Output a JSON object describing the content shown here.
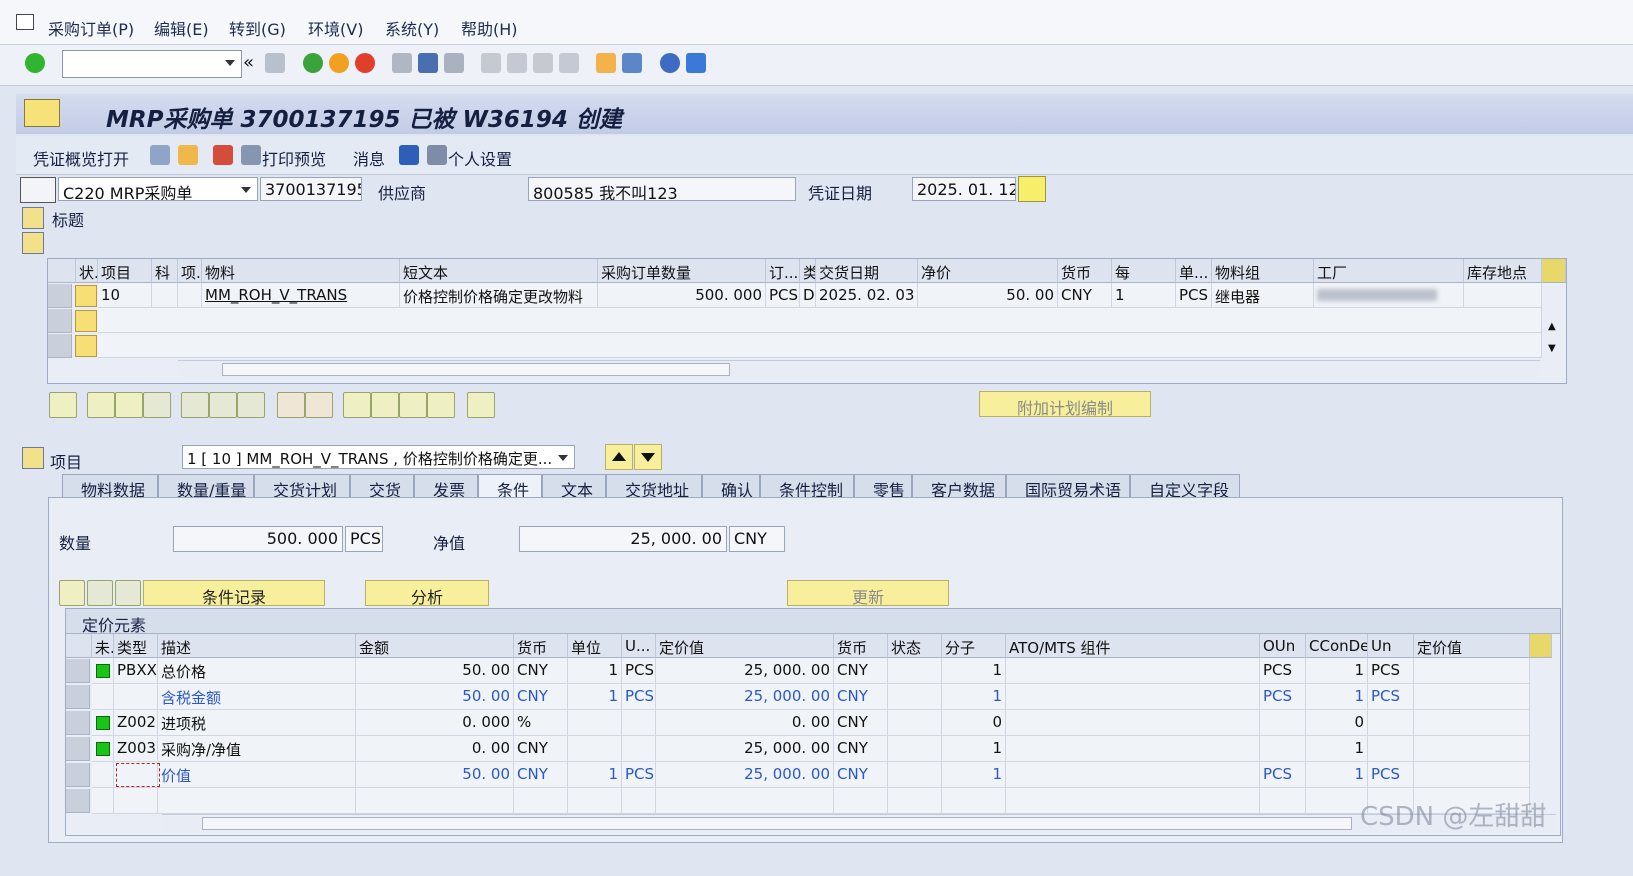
{
  "menu": [
    "采购订单(P)",
    "编辑(E)",
    "转到(G)",
    "环境(V)",
    "系统(Y)",
    "帮助(H)"
  ],
  "title": "MRP采购单 3700137195 已被 W36194 创建",
  "app_toolbar": {
    "overview": "凭证概览打开",
    "print_preview": "打印预览",
    "messages": "消息",
    "personal": "个人设置"
  },
  "header": {
    "doc_type": "C220 MRP采购单",
    "po_number": "3700137195",
    "vendor_label": "供应商",
    "vendor": "800585 我不叫123",
    "date_label": "凭证日期",
    "date": "2025. 01. 12",
    "header_label": "标题"
  },
  "items_table": {
    "columns": [
      "状.",
      "项目",
      "科",
      "项.",
      "物料",
      "短文本",
      "采购订单数量",
      "订...",
      "类",
      "交货日期",
      "净价",
      "货币",
      "每",
      "单...",
      "物料组",
      "工厂",
      "库存地点"
    ],
    "rows": [
      {
        "item": "10",
        "material": "MM_ROH_V_TRANS",
        "short_text": "价格控制价格确定更改物料",
        "qty": "500. 000",
        "uom": "PCS",
        "cat": "D",
        "delivery": "2025. 02. 03",
        "price": "50. 00",
        "currency": "CNY",
        "per": "1",
        "unit": "PCS",
        "matl_group": "继电器",
        "plant": "",
        "sloc": ""
      }
    ]
  },
  "extra_planning": "附加计划编制",
  "item_section": {
    "label": "项目",
    "selector": "1 [ 10 ] MM_ROH_V_TRANS , 价格控制价格确定更..."
  },
  "tabs": [
    "物料数据",
    "数量/重量",
    "交货计划",
    "交货",
    "发票",
    "条件",
    "文本",
    "交货地址",
    "确认",
    "条件控制",
    "零售",
    "客户数据",
    "国际贸易术语",
    "自定义字段"
  ],
  "active_tab": "条件",
  "conditions": {
    "qty_label": "数量",
    "qty": "500. 000",
    "qty_unit": "PCS",
    "net_label": "净值",
    "net": "25, 000. 00",
    "net_currency": "CNY",
    "btn_records": "条件记录",
    "btn_analysis": "分析",
    "btn_update": "更新",
    "pricing_title": "定价元素",
    "columns": [
      "未.",
      "类型",
      "描述",
      "金额",
      "货币",
      "单位",
      "U...",
      "定价值",
      "货币",
      "状态",
      "分子",
      "ATO/MTS 组件",
      "OUn",
      "CConDe",
      "Un",
      "定价值"
    ],
    "rows": [
      {
        "status": "green",
        "type": "PBXX",
        "desc": "总价格",
        "amount": "50. 00",
        "cur": "CNY",
        "unit": "1",
        "u": "PCS",
        "value": "25, 000. 00",
        "vcur": "CNY",
        "num": "1",
        "oun": "PCS",
        "ccon": "1",
        "un": "PCS",
        "blue": false
      },
      {
        "status": "",
        "type": "",
        "desc": "含税金额",
        "amount": "50. 00",
        "cur": "CNY",
        "unit": "1",
        "u": "PCS",
        "value": "25, 000. 00",
        "vcur": "CNY",
        "num": "1",
        "oun": "PCS",
        "ccon": "1",
        "un": "PCS",
        "blue": true
      },
      {
        "status": "green",
        "type": "Z002",
        "desc": "进项税",
        "amount": "0. 000",
        "cur": "%",
        "unit": "",
        "u": "",
        "value": "0. 00",
        "vcur": "CNY",
        "num": "0",
        "oun": "",
        "ccon": "0",
        "un": "",
        "blue": false
      },
      {
        "status": "green",
        "type": "Z003",
        "desc": "采购净/净值",
        "amount": "0. 00",
        "cur": "CNY",
        "unit": "",
        "u": "",
        "value": "25, 000. 00",
        "vcur": "CNY",
        "num": "1",
        "oun": "",
        "ccon": "1",
        "un": "",
        "blue": false
      },
      {
        "status": "",
        "type": "",
        "desc": "价值",
        "amount": "50. 00",
        "cur": "CNY",
        "unit": "1",
        "u": "PCS",
        "value": "25, 000. 00",
        "vcur": "CNY",
        "num": "1",
        "oun": "PCS",
        "ccon": "1",
        "un": "PCS",
        "blue": true
      }
    ]
  },
  "watermark": "CSDN @左甜甜"
}
